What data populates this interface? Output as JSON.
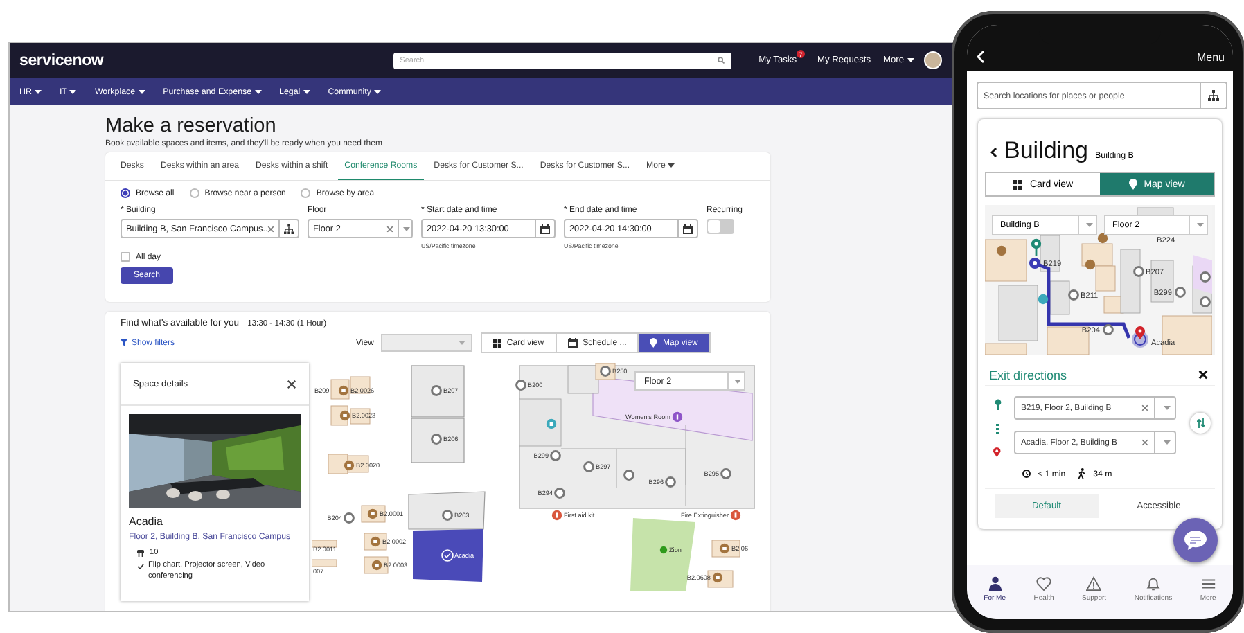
{
  "desktop": {
    "header": {
      "logo": "servicenow",
      "search_placeholder": "Search",
      "links": [
        {
          "label": "My Tasks",
          "badge": "7",
          "kind": "link"
        },
        {
          "label": "My Requests",
          "kind": "link"
        },
        {
          "label": "More",
          "kind": "menu"
        }
      ]
    },
    "nav": [
      "HR",
      "IT",
      "Workplace",
      "Purchase and Expense",
      "Legal",
      "Community"
    ],
    "title": "Make a reservation",
    "subtitle": "Book available spaces and items, and they'll be ready when you need them",
    "tabs": [
      {
        "label": "Desks",
        "selected": false,
        "kind": "tab"
      },
      {
        "label": "Desks within an area",
        "selected": false,
        "kind": "tab"
      },
      {
        "label": "Desks within a shift",
        "selected": false,
        "kind": "tab"
      },
      {
        "label": "Conference Rooms",
        "selected": true,
        "kind": "tab"
      },
      {
        "label": "Desks for Customer S...",
        "selected": false,
        "kind": "tab"
      },
      {
        "label": "Desks for Customer S...",
        "selected": false,
        "kind": "tab"
      },
      {
        "label": "More",
        "selected": false,
        "kind": "menu"
      }
    ],
    "browse_options": [
      {
        "label": "Browse all",
        "selected": true
      },
      {
        "label": "Browse near a person",
        "selected": false
      },
      {
        "label": "Browse by area",
        "selected": false
      }
    ],
    "building": {
      "label": "* Building",
      "value": "Building B, San Francisco Campus.."
    },
    "floor": {
      "label": "Floor",
      "value": "Floor 2"
    },
    "start": {
      "label": "* Start date and time",
      "value": "2022-04-20 13:30:00",
      "note": "US/Pacific timezone"
    },
    "end": {
      "label": "* End date and time",
      "value": "2022-04-20 14:30:00",
      "note": "US/Pacific timezone"
    },
    "recurring": {
      "label": "Recurring",
      "on": false
    },
    "all_day": {
      "label": "All day",
      "checked": false
    },
    "search_button": "Search",
    "results": {
      "title": "Find what's available for you",
      "time": "13:30 - 14:30 (1 Hour)",
      "filters_link": "Show filters",
      "view_label": "View",
      "views": [
        {
          "label": "Card view",
          "selected": false,
          "kind": "card"
        },
        {
          "label": "Schedule ...",
          "selected": false,
          "kind": "schedule"
        },
        {
          "label": "Map view",
          "selected": true,
          "kind": "map"
        }
      ]
    },
    "space_details": {
      "title": "Space details",
      "name": "Acadia",
      "location": "Floor 2, Building B, San Francisco Campus",
      "capacity": "10",
      "amenities": "Flip chart, Projector screen, Video conferencing"
    },
    "map": {
      "floor_select": "Floor 2",
      "labels": [
        {
          "label": "B209",
          "kind": "label"
        },
        {
          "label": "B2.0026",
          "kind": "desk"
        },
        {
          "label": "B207",
          "kind": "room"
        },
        {
          "label": "B2.0023",
          "kind": "desk"
        },
        {
          "label": "B206",
          "kind": "room"
        },
        {
          "label": "B2.0020",
          "kind": "desk"
        },
        {
          "label": "B200",
          "kind": "room"
        },
        {
          "label": "B250",
          "kind": "room"
        },
        {
          "label": "Women's Room",
          "kind": "amenity"
        },
        {
          "label": "B299",
          "kind": "room"
        },
        {
          "label": "B297",
          "kind": "room"
        },
        {
          "label": "B296",
          "kind": "room"
        },
        {
          "label": "B295",
          "kind": "room"
        },
        {
          "label": "B294",
          "kind": "room"
        },
        {
          "label": "B204",
          "kind": "room"
        },
        {
          "label": "B2.0001",
          "kind": "desk"
        },
        {
          "label": "B203",
          "kind": "room"
        },
        {
          "label": "First aid kit",
          "kind": "safety"
        },
        {
          "label": "Fire Extinguisher",
          "kind": "safety"
        },
        {
          "label": "B2.0011",
          "kind": "label"
        },
        {
          "label": "B2.0002",
          "kind": "desk"
        },
        {
          "label": "Acadia",
          "kind": "selected"
        },
        {
          "label": "Zion",
          "kind": "zone"
        },
        {
          "label": "B2.06",
          "kind": "desk"
        },
        {
          "label": "007",
          "kind": "label"
        },
        {
          "label": "B2.0003",
          "kind": "desk"
        },
        {
          "label": "B2.0608",
          "kind": "desk"
        }
      ]
    }
  },
  "phone": {
    "menu": "Menu",
    "search_placeholder": "Search locations for places or people",
    "title": "Building",
    "subtitle": "Building B",
    "views": [
      {
        "label": "Card view",
        "selected": false,
        "kind": "card"
      },
      {
        "label": "Map view",
        "selected": true,
        "kind": "map"
      }
    ],
    "map": {
      "building_select": "Building B",
      "floor_select": "Floor 2",
      "labels": [
        {
          "label": "B224",
          "kind": "label"
        },
        {
          "label": "B219",
          "kind": "start"
        },
        {
          "label": "B207",
          "kind": "room"
        },
        {
          "label": "B211",
          "kind": "room"
        },
        {
          "label": "B299",
          "kind": "room"
        },
        {
          "label": "B204",
          "kind": "room"
        },
        {
          "label": "Acadia",
          "kind": "end"
        }
      ]
    },
    "directions": {
      "title": "Exit directions",
      "from": "B219, Floor 2, Building B",
      "to": "Acadia, Floor 2, Building B",
      "duration": "< 1 min",
      "distance": "34 m",
      "modes": [
        {
          "label": "Default",
          "selected": true
        },
        {
          "label": "Accessible",
          "selected": false
        }
      ]
    },
    "bottom_nav": [
      {
        "label": "For Me",
        "selected": true,
        "kind": "person"
      },
      {
        "label": "Health",
        "selected": false,
        "kind": "heart"
      },
      {
        "label": "Support",
        "selected": false,
        "kind": "warning"
      },
      {
        "label": "Notifications",
        "selected": false,
        "kind": "bell"
      },
      {
        "label": "More",
        "selected": false,
        "kind": "menu"
      }
    ]
  }
}
